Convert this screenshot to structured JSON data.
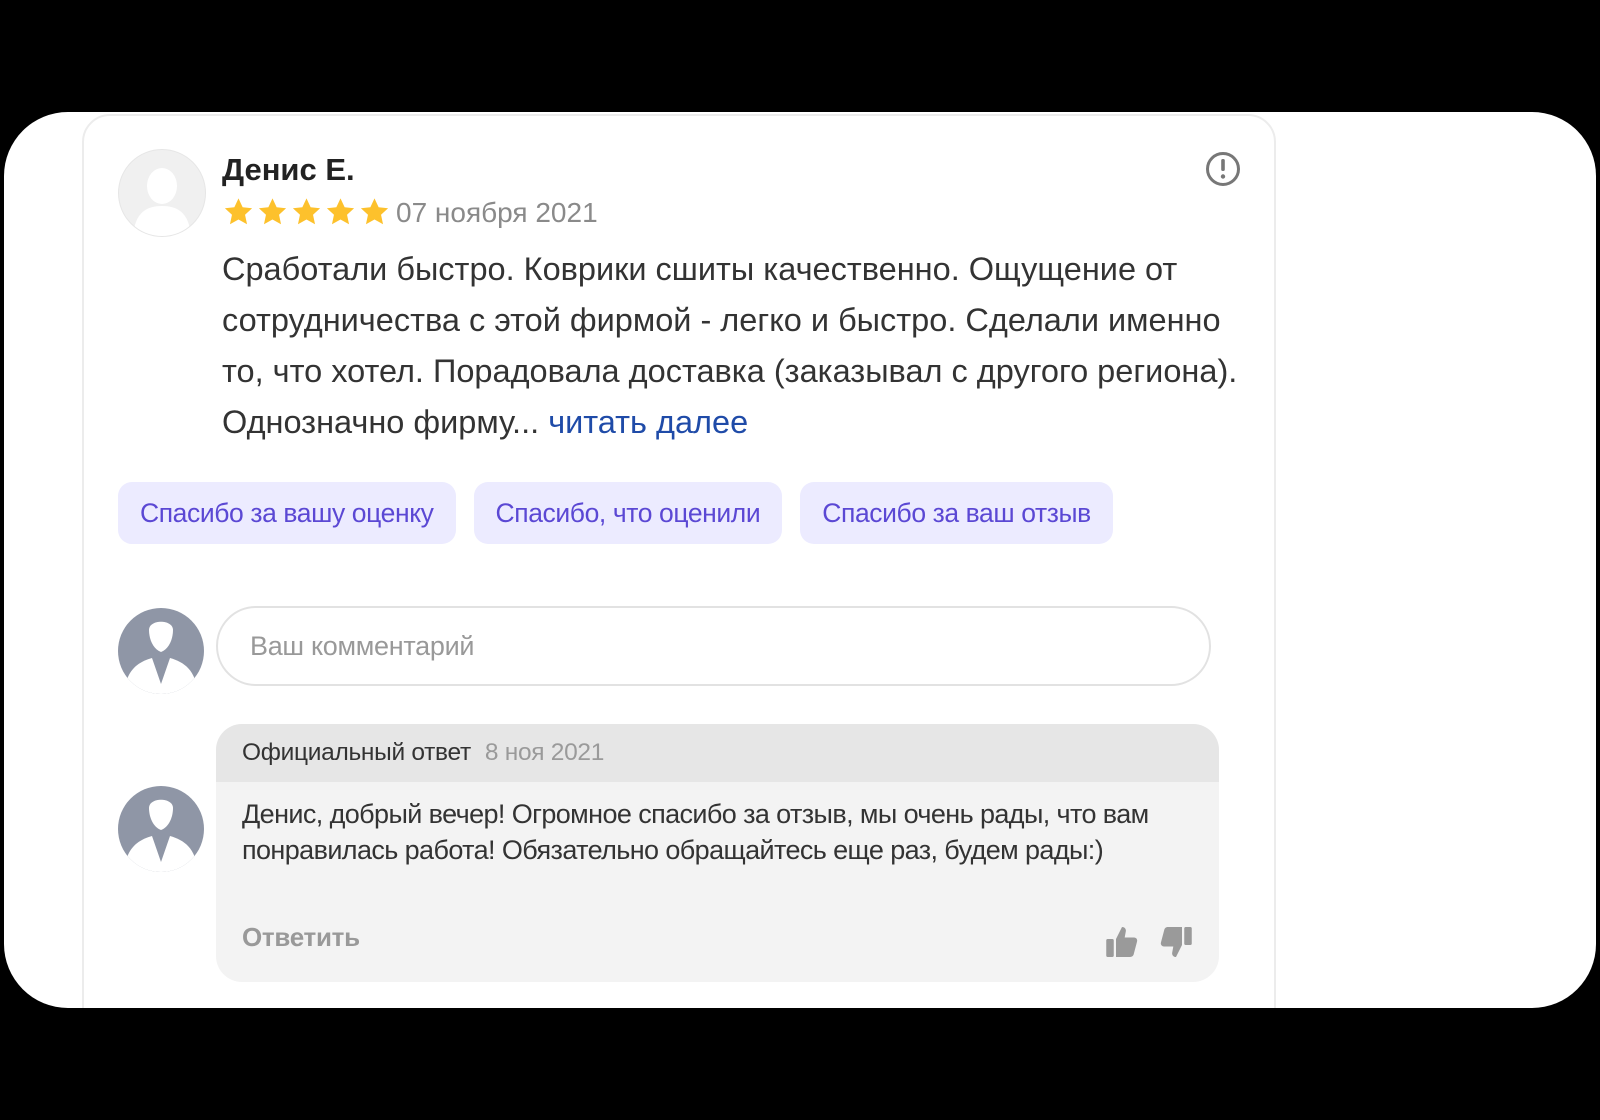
{
  "review": {
    "author": "Денис Е.",
    "rating": 5,
    "date": "07 ноября 2021",
    "text": "Сработали быстро. Коврики сшиты качественно. Ощущение от сотрудничества с этой фирмой - легко и быстро. Сделали именно то, что хотел. Порадовала доставка (заказывал с другого региона). Однозначно фирму...",
    "read_more": "читать далее"
  },
  "quick_replies": [
    "Спасибо за вашу оценку",
    "Спасибо, что оценили",
    "Спасибо за ваш отзыв"
  ],
  "comment": {
    "placeholder": "Ваш комментарий"
  },
  "official_reply": {
    "title": "Официальный ответ",
    "date": "8 ноя 2021",
    "text": "Денис, добрый вечер! Огромное спасибо за отзыв, мы очень рады, что вам понравилась работа! Обязательно обращайтесь еще раз, будем рады:)",
    "answer_label": "Ответить"
  },
  "colors": {
    "star": "#fdc12c",
    "chip_bg": "#ecebff",
    "chip_text": "#5b48d4",
    "link": "#1f4ba8"
  },
  "icons": [
    "user-avatar-icon",
    "star-icon",
    "info-icon",
    "user-silhouette-icon",
    "thumb-up-icon",
    "thumb-down-icon"
  ]
}
